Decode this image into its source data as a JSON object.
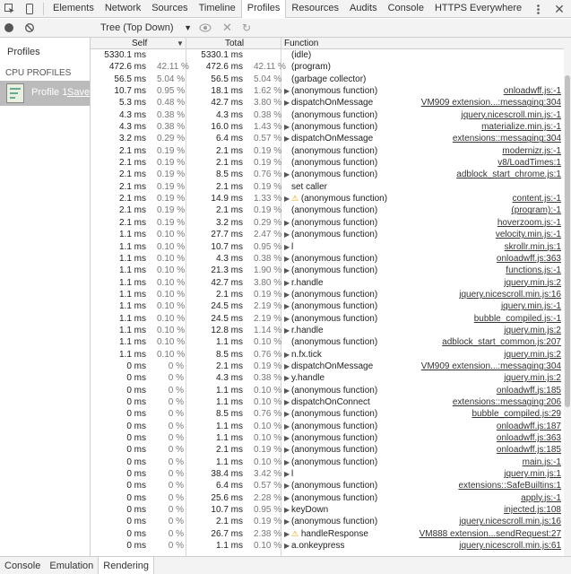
{
  "tabs": [
    "Elements",
    "Network",
    "Sources",
    "Timeline",
    "Profiles",
    "Resources",
    "Audits",
    "Console",
    "HTTPS Everywhere"
  ],
  "active_tab": "Profiles",
  "view_select": "Tree (Top Down)",
  "sidebar": {
    "title": "Profiles",
    "section": "CPU PROFILES",
    "profile_name": "Profile 1",
    "save": "Save"
  },
  "columns": {
    "self": "Self",
    "total": "Total",
    "function": "Function"
  },
  "rows": [
    [
      "5330.1 ms",
      "",
      "5330.1 ms",
      "",
      "n",
      "(idle)",
      ""
    ],
    [
      "472.6 ms",
      "42.11 %",
      "472.6 ms",
      "42.11 %",
      "n",
      "(program)",
      ""
    ],
    [
      "56.5 ms",
      "5.04 %",
      "56.5 ms",
      "5.04 %",
      "n",
      "(garbage collector)",
      ""
    ],
    [
      "10.7 ms",
      "0.95 %",
      "18.1 ms",
      "1.62 %",
      "t",
      "(anonymous function)",
      "onloadwff.js:-1"
    ],
    [
      "5.3 ms",
      "0.48 %",
      "42.7 ms",
      "3.80 %",
      "t",
      "dispatchOnMessage",
      "VM909 extension...:messaging:304"
    ],
    [
      "4.3 ms",
      "0.38 %",
      "4.3 ms",
      "0.38 %",
      "n",
      "(anonymous function)",
      "jquery.nicescroll.min.js:-1"
    ],
    [
      "4.3 ms",
      "0.38 %",
      "16.0 ms",
      "1.43 %",
      "t",
      "(anonymous function)",
      "materialize.min.js:-1"
    ],
    [
      "3.2 ms",
      "0.29 %",
      "6.4 ms",
      "0.57 %",
      "t",
      "dispatchOnMessage",
      "extensions::messaging:304"
    ],
    [
      "2.1 ms",
      "0.19 %",
      "2.1 ms",
      "0.19 %",
      "n",
      "(anonymous function)",
      "modernizr.js:-1"
    ],
    [
      "2.1 ms",
      "0.19 %",
      "2.1 ms",
      "0.19 %",
      "n",
      "(anonymous function)",
      "v8/LoadTimes:1"
    ],
    [
      "2.1 ms",
      "0.19 %",
      "8.5 ms",
      "0.76 %",
      "t",
      "(anonymous function)",
      "adblock_start_chrome.js:1"
    ],
    [
      "2.1 ms",
      "0.19 %",
      "2.1 ms",
      "0.19 %",
      "n",
      "set caller",
      ""
    ],
    [
      "2.1 ms",
      "0.19 %",
      "14.9 ms",
      "1.33 %",
      "w",
      "(anonymous function)",
      "content.js:-1"
    ],
    [
      "2.1 ms",
      "0.19 %",
      "2.1 ms",
      "0.19 %",
      "n",
      "(anonymous function)",
      "(program):-1"
    ],
    [
      "2.1 ms",
      "0.19 %",
      "3.2 ms",
      "0.29 %",
      "t",
      "(anonymous function)",
      "hoverzoom.js:-1"
    ],
    [
      "1.1 ms",
      "0.10 %",
      "27.7 ms",
      "2.47 %",
      "t",
      "(anonymous function)",
      "velocity.min.js:-1"
    ],
    [
      "1.1 ms",
      "0.10 %",
      "10.7 ms",
      "0.95 %",
      "t",
      "l",
      "skrollr.min.js:1"
    ],
    [
      "1.1 ms",
      "0.10 %",
      "4.3 ms",
      "0.38 %",
      "t",
      "(anonymous function)",
      "onloadwff.js:363"
    ],
    [
      "1.1 ms",
      "0.10 %",
      "21.3 ms",
      "1.90 %",
      "t",
      "(anonymous function)",
      "functions.js:-1"
    ],
    [
      "1.1 ms",
      "0.10 %",
      "42.7 ms",
      "3.80 %",
      "t",
      "r.handle",
      "jquery.min.js:2"
    ],
    [
      "1.1 ms",
      "0.10 %",
      "2.1 ms",
      "0.19 %",
      "t",
      "(anonymous function)",
      "jquery.nicescroll.min.js:16"
    ],
    [
      "1.1 ms",
      "0.10 %",
      "24.5 ms",
      "2.19 %",
      "t",
      "(anonymous function)",
      "jquery.min.js:-1"
    ],
    [
      "1.1 ms",
      "0.10 %",
      "24.5 ms",
      "2.19 %",
      "t",
      "(anonymous function)",
      "bubble_compiled.js:-1"
    ],
    [
      "1.1 ms",
      "0.10 %",
      "12.8 ms",
      "1.14 %",
      "t",
      "r.handle",
      "jquery.min.js:2"
    ],
    [
      "1.1 ms",
      "0.10 %",
      "1.1 ms",
      "0.10 %",
      "n",
      "(anonymous function)",
      "adblock_start_common.js:207"
    ],
    [
      "1.1 ms",
      "0.10 %",
      "8.5 ms",
      "0.76 %",
      "t",
      "n.fx.tick",
      "jquery.min.js:2"
    ],
    [
      "0 ms",
      "0 %",
      "2.1 ms",
      "0.19 %",
      "t",
      "dispatchOnMessage",
      "VM909 extension...:messaging:304"
    ],
    [
      "0 ms",
      "0 %",
      "4.3 ms",
      "0.38 %",
      "t",
      "y.handle",
      "jquery.min.js:2"
    ],
    [
      "0 ms",
      "0 %",
      "1.1 ms",
      "0.10 %",
      "t",
      "(anonymous function)",
      "onloadwff.js:185"
    ],
    [
      "0 ms",
      "0 %",
      "1.1 ms",
      "0.10 %",
      "t",
      "dispatchOnConnect",
      "extensions::messaging:206"
    ],
    [
      "0 ms",
      "0 %",
      "8.5 ms",
      "0.76 %",
      "t",
      "(anonymous function)",
      "bubble_compiled.js:29"
    ],
    [
      "0 ms",
      "0 %",
      "1.1 ms",
      "0.10 %",
      "t",
      "(anonymous function)",
      "onloadwff.js:187"
    ],
    [
      "0 ms",
      "0 %",
      "1.1 ms",
      "0.10 %",
      "t",
      "(anonymous function)",
      "onloadwff.js:363"
    ],
    [
      "0 ms",
      "0 %",
      "2.1 ms",
      "0.19 %",
      "t",
      "(anonymous function)",
      "onloadwff.js:185"
    ],
    [
      "0 ms",
      "0 %",
      "1.1 ms",
      "0.10 %",
      "t",
      "(anonymous function)",
      "main.js:-1"
    ],
    [
      "0 ms",
      "0 %",
      "38.4 ms",
      "3.42 %",
      "t",
      "l",
      "jquery.min.js:1"
    ],
    [
      "0 ms",
      "0 %",
      "6.4 ms",
      "0.57 %",
      "t",
      "(anonymous function)",
      "extensions::SafeBuiltins:1"
    ],
    [
      "0 ms",
      "0 %",
      "25.6 ms",
      "2.28 %",
      "t",
      "(anonymous function)",
      "apply.js:-1"
    ],
    [
      "0 ms",
      "0 %",
      "10.7 ms",
      "0.95 %",
      "t",
      "keyDown",
      "injected.js:108"
    ],
    [
      "0 ms",
      "0 %",
      "2.1 ms",
      "0.19 %",
      "t",
      "(anonymous function)",
      "jquery.nicescroll.min.js:16"
    ],
    [
      "0 ms",
      "0 %",
      "26.7 ms",
      "2.38 %",
      "w",
      "handleResponse",
      "VM888 extension...sendRequest:27"
    ],
    [
      "0 ms",
      "0 %",
      "1.1 ms",
      "0.10 %",
      "t",
      "a.onkeypress",
      "jquery.nicescroll.min.js:61"
    ]
  ],
  "bottom_tabs": [
    "Console",
    "Emulation",
    "Rendering"
  ],
  "active_bottom": "Rendering"
}
